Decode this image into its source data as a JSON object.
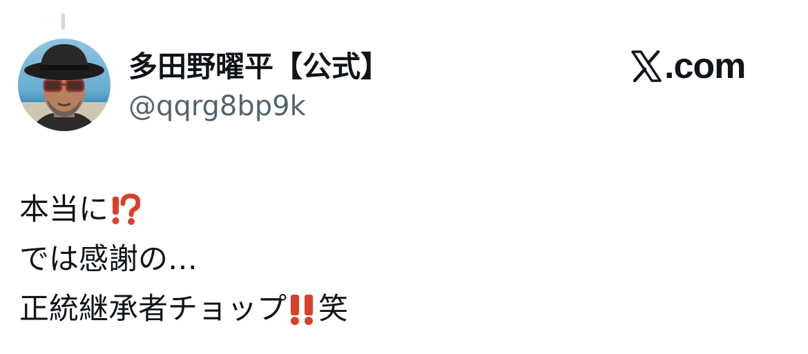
{
  "author": {
    "display_name": "多田野曜平【公式】",
    "handle": "@qqrg8bp9k",
    "avatar": "profile-photo-man-in-hat-and-glasses"
  },
  "brand": {
    "logo": "x-logo-icon",
    "domain": ".com"
  },
  "tweet": {
    "lines": [
      {
        "text": "本当に",
        "emoji": "exclamation-question-mark-icon",
        "emoji_color": "#d9402a"
      },
      {
        "text": "では感謝の…"
      },
      {
        "text": "正統継承者チョップ",
        "emoji": "double-exclamation-mark-icon",
        "emoji_color": "#d9402a",
        "suffix": "笑"
      }
    ]
  },
  "colors": {
    "text_primary": "#0f1419",
    "text_secondary": "#536471",
    "thread_line": "#cfd9de",
    "emoji_red": "#d9402a"
  }
}
